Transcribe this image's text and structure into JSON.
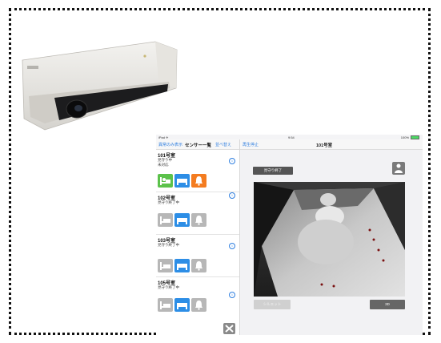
{
  "status_bar": {
    "carrier": "iPad ✈",
    "time": "9:54",
    "battery": "100%"
  },
  "sidebar": {
    "nav_left": "異常のみ表示",
    "nav_title": "センサー一覧",
    "nav_right": "並べ替え",
    "rooms": [
      {
        "name": "101号室",
        "status_lines": [
          "見守り中",
          "未対応"
        ]
      },
      {
        "name": "102号室",
        "status_lines": [
          "見守り終了中"
        ]
      },
      {
        "name": "103号室",
        "status_lines": [
          "見守り終了中"
        ]
      },
      {
        "name": "105号室",
        "status_lines": [
          "見守り終了中"
        ]
      }
    ],
    "info_glyph": "i",
    "bed_label": "(在床)"
  },
  "detail": {
    "stop_label": "再生停止",
    "title": "101号室",
    "end_button": "見守り終了",
    "silhouette_button": "シルエット",
    "button_3d": "3D"
  },
  "colors": {
    "accent": "#2f7fe0",
    "green": "#5cc24b",
    "blue": "#2d8ee6",
    "orange": "#f47c20",
    "gray": "#b7b7b7"
  },
  "icons": [
    "bed-icon",
    "sensor-icon",
    "bell-icon",
    "person-icon",
    "settings-icon",
    "info-icon",
    "wifi-icon",
    "battery-icon"
  ]
}
